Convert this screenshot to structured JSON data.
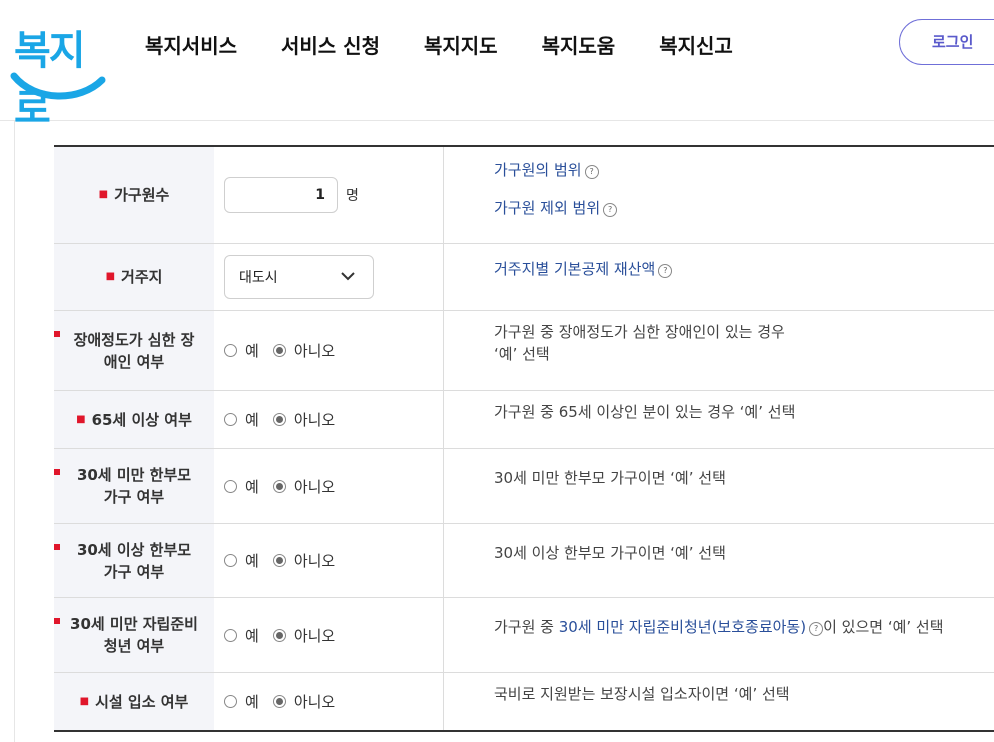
{
  "logo": {
    "text": "복지로"
  },
  "nav": [
    "복지서비스",
    "서비스 신청",
    "복지지도",
    "복지도움",
    "복지신고"
  ],
  "login_label": "로그인",
  "rows": [
    {
      "label": "가구원수",
      "input_value": "1",
      "unit": "명",
      "desc_links": [
        "가구원의 범위",
        "가구원 제외 범위"
      ]
    },
    {
      "label": "거주지",
      "select_value": "대도시",
      "desc_links": [
        "거주지별 기본공제 재산액"
      ]
    },
    {
      "label_lines": [
        "장애정도가 심한 장",
        "애인 여부"
      ],
      "yes": "예",
      "no": "아니오",
      "desc_lines": [
        "가구원 중 장애정도가 심한 장애인이 있는 경우",
        "‘예’ 선택"
      ]
    },
    {
      "label": "65세 이상 여부",
      "yes": "예",
      "no": "아니오",
      "desc": "가구원 중 65세 이상인 분이 있는 경우 ‘예’ 선택"
    },
    {
      "label_lines": [
        "30세 미만 한부모",
        "가구 여부"
      ],
      "yes": "예",
      "no": "아니오",
      "desc": "30세 미만 한부모 가구이면 ‘예’ 선택"
    },
    {
      "label_lines": [
        "30세 이상 한부모",
        "가구 여부"
      ],
      "yes": "예",
      "no": "아니오",
      "desc": "30세 이상 한부모 가구이면 ‘예’ 선택"
    },
    {
      "label_lines": [
        "30세 미만 자립준비",
        "청년 여부"
      ],
      "yes": "예",
      "no": "아니오",
      "desc_pre": "가구원 중 ",
      "desc_link": "30세 미만 자립준비청년(보호종료아동)",
      "desc_post": "이 있으면 ‘예’ 선택"
    },
    {
      "label": "시설 입소 여부",
      "yes": "예",
      "no": "아니오",
      "desc": "국비로 지원받는 보장시설 입소자이면 ‘예’ 선택"
    }
  ],
  "help_icon_glyph": "?",
  "colors": {
    "required": "#e0162b",
    "link": "#2a4f9a",
    "logo": "#1aa6e6",
    "login": "#5a5acb"
  }
}
